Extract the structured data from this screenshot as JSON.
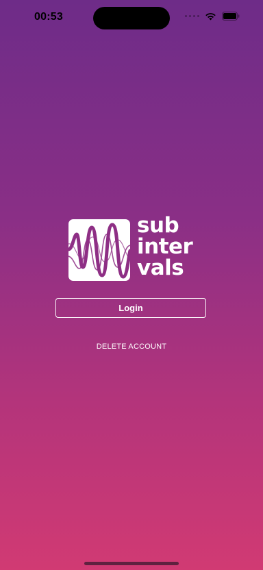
{
  "status_bar": {
    "time": "00:53",
    "icons": [
      "signal-dots-icon",
      "wifi-icon",
      "battery-icon"
    ]
  },
  "logo": {
    "brand_lines": [
      "sub",
      "inter",
      "vals"
    ],
    "mark_icon": "waveform-icon"
  },
  "actions": {
    "login_label": "Login",
    "delete_account_label": "DELETE ACCOUNT"
  },
  "colors": {
    "gradient_top": "#6E2C88",
    "gradient_bottom": "#D13A73",
    "logo_wave": "#8E2F85",
    "text": "#FFFFFF"
  }
}
